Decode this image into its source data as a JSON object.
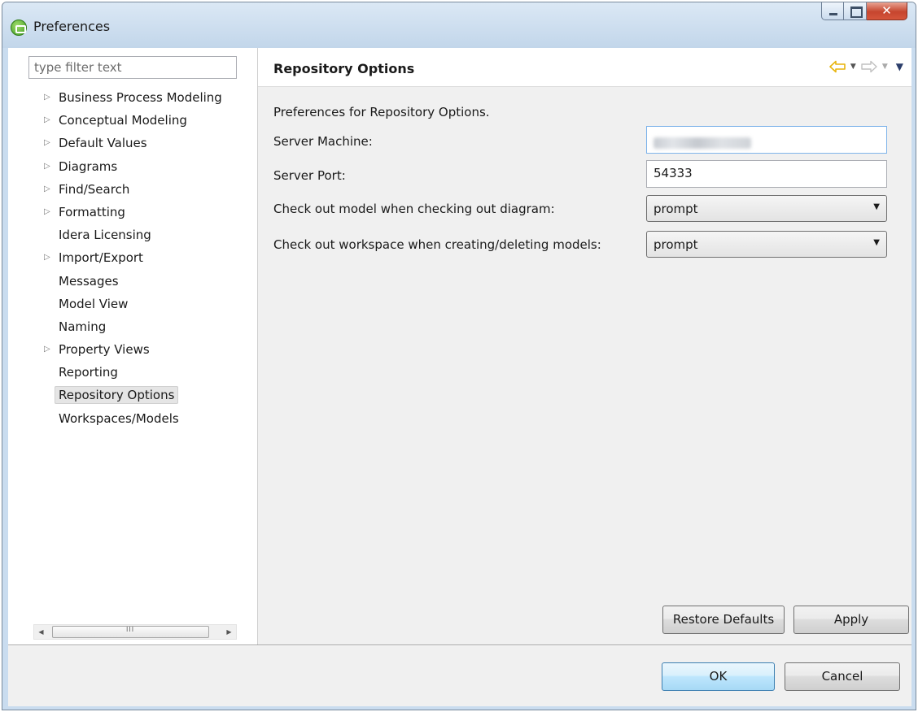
{
  "window": {
    "title": "Preferences"
  },
  "filter": {
    "placeholder": "type filter text"
  },
  "tree": {
    "items": [
      {
        "label": "Business Process Modeling",
        "expandable": true
      },
      {
        "label": "Conceptual Modeling",
        "expandable": true
      },
      {
        "label": "Default Values",
        "expandable": true
      },
      {
        "label": "Diagrams",
        "expandable": true
      },
      {
        "label": "Find/Search",
        "expandable": true
      },
      {
        "label": "Formatting",
        "expandable": true
      },
      {
        "label": "Idera Licensing",
        "expandable": false
      },
      {
        "label": "Import/Export",
        "expandable": true
      },
      {
        "label": "Messages",
        "expandable": false
      },
      {
        "label": "Model View",
        "expandable": false
      },
      {
        "label": "Naming",
        "expandable": false
      },
      {
        "label": "Property Views",
        "expandable": true
      },
      {
        "label": "Reporting",
        "expandable": false
      },
      {
        "label": "Repository Options",
        "expandable": false,
        "selected": true
      },
      {
        "label": "Workspaces/Models",
        "expandable": false
      }
    ]
  },
  "page": {
    "title": "Repository Options",
    "description": "Preferences for Repository Options.",
    "server_machine_label": "Server Machine:",
    "server_port_label": "Server Port:",
    "server_port_value": "54333",
    "checkout_model_label": "Check out model when checking out diagram:",
    "checkout_model_value": "prompt",
    "checkout_workspace_label": "Check out workspace when creating/deleting models:",
    "checkout_workspace_value": "prompt"
  },
  "buttons": {
    "restore_defaults": "Restore Defaults",
    "apply": "Apply",
    "ok": "OK",
    "cancel": "Cancel"
  },
  "colors": {
    "title_bar": "#c2d6ea",
    "selected_item": "#e5e5e5",
    "back_arrow": "#e8b40c",
    "default_button": "#bee6fd"
  }
}
